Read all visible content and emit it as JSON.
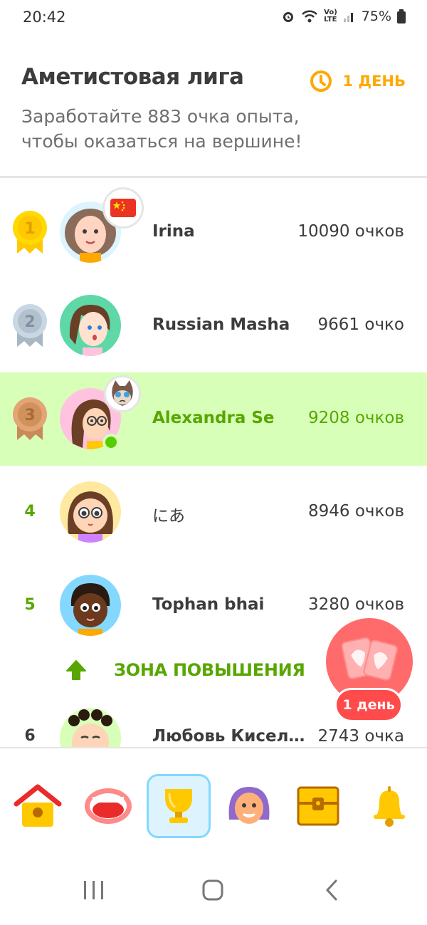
{
  "status_bar": {
    "time": "20:42",
    "battery": "75%",
    "network": "VoLTE"
  },
  "header": {
    "title": "Аметистовая лига",
    "timer": "1 ДЕНЬ",
    "subtitle": "Заработайте 883 очка опыта, чтобы оказаться на вершине!"
  },
  "leaderboard": [
    {
      "rank": "1",
      "medal": "gold",
      "name": "Irina",
      "score": "10090 очков",
      "badge": "china-flag"
    },
    {
      "rank": "2",
      "medal": "silver",
      "name": "Russian Masha",
      "score": "9661 очко"
    },
    {
      "rank": "3",
      "medal": "bronze",
      "name": "Alexandra Se",
      "score": "9208 очков",
      "is_current_user": true,
      "badge": "cat",
      "online": true
    },
    {
      "rank": "4",
      "name": "にあ",
      "score": "8946 очков"
    },
    {
      "rank": "5",
      "name": "Tophan bhai",
      "score": "3280 очков"
    },
    {
      "rank": "6",
      "name": "Любовь Кисел…",
      "score": "2743 очка"
    }
  ],
  "promotion_zone": {
    "label": "ЗОНА ПОВЫШЕНИЯ"
  },
  "chest_button": {
    "label": "1 день"
  },
  "tabs": [
    {
      "icon": "home-icon"
    },
    {
      "icon": "speak-icon"
    },
    {
      "icon": "trophy-icon",
      "active": true
    },
    {
      "icon": "profile-icon"
    },
    {
      "icon": "chest-icon"
    },
    {
      "icon": "bell-icon"
    }
  ],
  "colors": {
    "green": "#58a700",
    "highlight": "#d7ffb8",
    "orange": "#ffa800",
    "red": "#ff4b4b",
    "blue": "#84d8ff"
  }
}
